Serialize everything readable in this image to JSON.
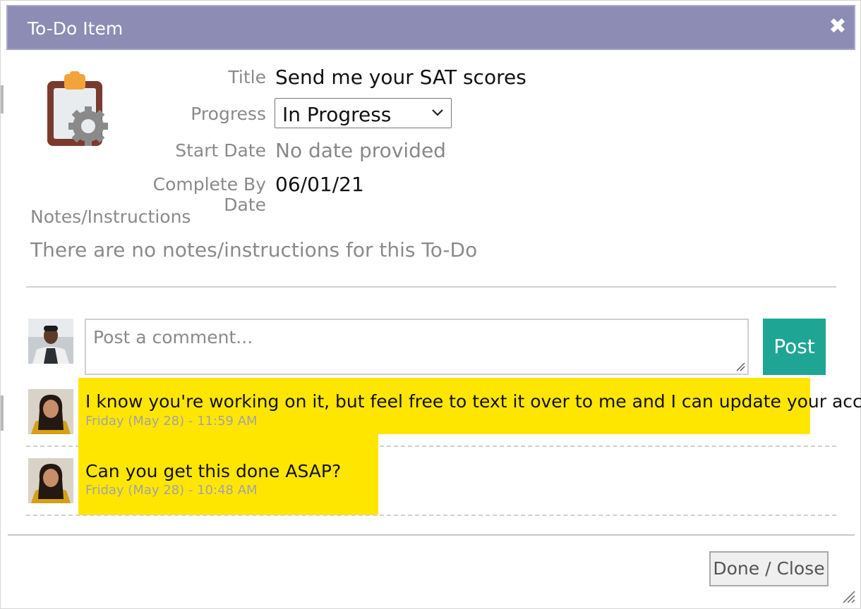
{
  "dialog": {
    "title": "To-Do Item",
    "close_icon": "close-icon",
    "colors": {
      "titlebar": "#8c8cb4",
      "post_button": "#1fa594",
      "comment_highlight": "#ffe600"
    }
  },
  "todo": {
    "icon": "clipboard-gear-icon",
    "title_label": "Title",
    "title_value": "Send me your SAT scores",
    "progress_label": "Progress",
    "progress_value": "In Progress",
    "start_date_label": "Start Date",
    "start_date_value": "No date provided",
    "complete_by_label": "Complete By Date",
    "complete_by_value": "06/01/21",
    "notes_label": "Notes/Instructions",
    "notes_value": "There are no notes/instructions for this To-Do"
  },
  "comment_form": {
    "placeholder": "Post a comment...",
    "post_label": "Post"
  },
  "comments": [
    {
      "text": "I know you're working on it, but feel free to text it over to me and I can update your account",
      "time": "Friday (May 28) - 11:59 AM"
    },
    {
      "text": "Can you get this done ASAP?",
      "time": "Friday (May 28) - 10:48 AM"
    }
  ],
  "footer": {
    "done_label": "Done / Close"
  }
}
